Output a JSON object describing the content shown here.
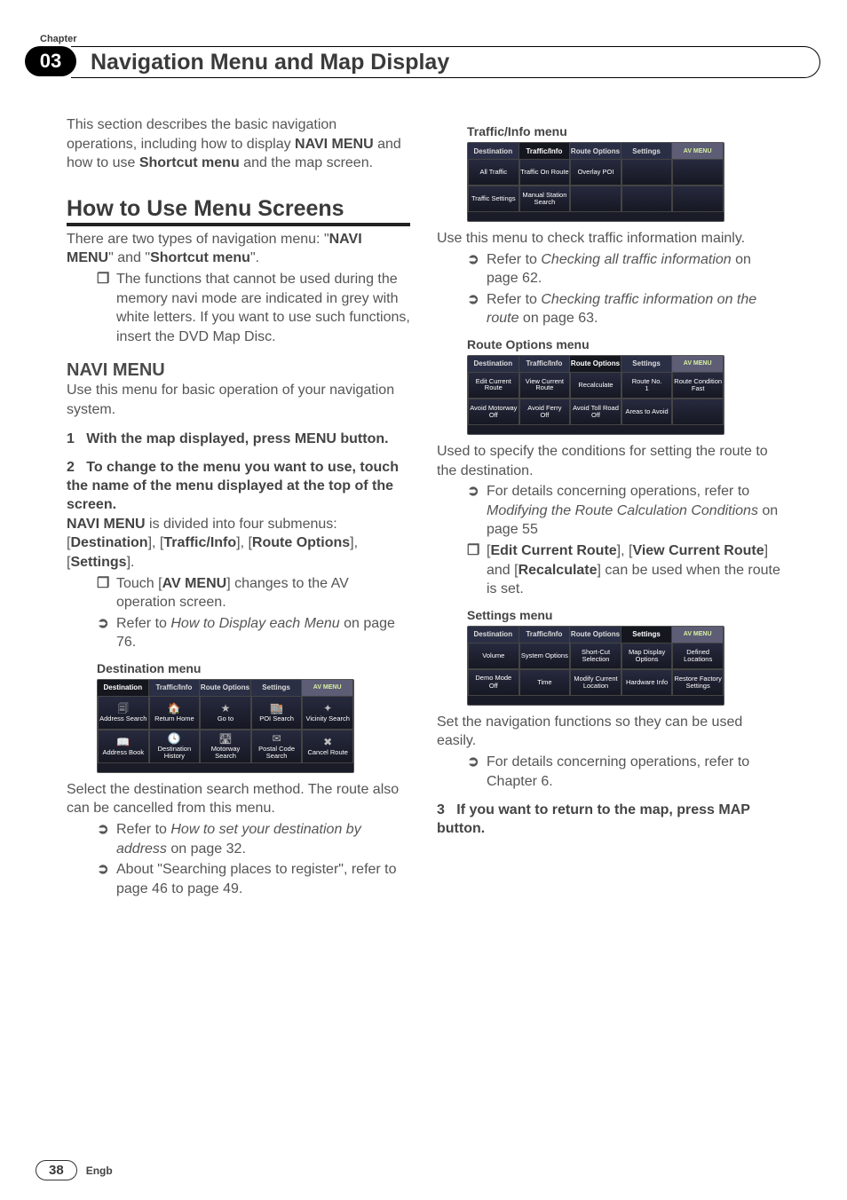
{
  "chapter": {
    "label": "Chapter",
    "number": "03",
    "title": "Navigation Menu and Map Display"
  },
  "footer": {
    "page": "38",
    "lang": "Engb"
  },
  "left": {
    "intro": "This section describes the basic navigation operations, including how to display ",
    "intro_b1": "NAVI MENU",
    "intro_mid": " and how to use ",
    "intro_b2": "Shortcut menu",
    "intro_end": " and the map screen.",
    "h1": "How to Use Menu Screens",
    "p1a": "There are two types of navigation menu: \"",
    "p1b": "NAVI MENU",
    "p1c": "\" and \"",
    "p1d": "Shortcut menu",
    "p1e": "\".",
    "b1": "The functions that cannot be used during the memory navi mode are indicated in grey with white letters. If you want to use such functions, insert the DVD Map Disc.",
    "h2": "NAVI MENU",
    "p2": "Use this menu for basic operation of your navigation system.",
    "s1n": "1",
    "s1": "With the map displayed, press MENU button.",
    "s2n": "2",
    "s2": "To change to the menu you want to use, touch the name of the menu displayed at the top of the screen.",
    "p3a": "NAVI MENU",
    "p3b": " is divided into four submenus: [",
    "p3c": "Destination",
    "p3d": "], [",
    "p3e": "Traffic/Info",
    "p3f": "], [",
    "p3g": "Route Options",
    "p3h": "], [",
    "p3i": "Settings",
    "p3j": "].",
    "b2a": "Touch [",
    "b2b": "AV MENU",
    "b2c": "] changes to the AV operation screen.",
    "b3a": "Refer to ",
    "b3b": "How to Display each Menu",
    "b3c": " on page 76.",
    "cap1": "Destination menu",
    "shot1": {
      "tabs": [
        "Destination",
        "Traffic/Info",
        "Route Options",
        "Settings",
        "AV MENU"
      ],
      "row1": [
        "Address Search",
        "Return Home",
        "Go to",
        "POI Search",
        "Vicinity Search"
      ],
      "row2": [
        "Address Book",
        "Destination History",
        "Motorway Search",
        "Postal Code Search",
        "Cancel Route"
      ]
    },
    "p4": "Select the destination search method. The route also can be cancelled from this menu.",
    "b4a": "Refer to ",
    "b4b": "How to set your destination by address",
    "b4c": " on page 32.",
    "b5": "About \"Searching places to register\", refer to page 46 to page 49."
  },
  "right": {
    "cap2": "Traffic/Info menu",
    "shot2": {
      "tabs": [
        "Destination",
        "Traffic/Info",
        "Route Options",
        "Settings",
        "AV MENU"
      ],
      "row1": [
        "All Traffic",
        "Traffic On Route",
        "Overlay POI",
        "",
        ""
      ],
      "row2": [
        "Traffic Settings",
        "Manual Station Search",
        "",
        "",
        ""
      ]
    },
    "p5": "Use this menu to check traffic information mainly.",
    "b6a": "Refer to ",
    "b6b": "Checking all traffic information",
    "b6c": " on page 62.",
    "b7a": "Refer to ",
    "b7b": "Checking traffic information on the route",
    "b7c": " on page 63.",
    "cap3": "Route Options menu",
    "shot3": {
      "tabs": [
        "Destination",
        "Traffic/Info",
        "Route Options",
        "Settings",
        "AV MENU"
      ],
      "row1": [
        "Edit Current Route",
        "View Current Route",
        "Recalculate",
        "Route No.",
        "Route Condition"
      ],
      "row1sub": [
        "",
        "",
        "",
        "1",
        "Fast"
      ],
      "row2": [
        "Avoid Motorway",
        "Avoid Ferry",
        "Avoid Toll Road",
        "Areas to Avoid",
        ""
      ],
      "row2sub": [
        "Off",
        "Off",
        "Off",
        "",
        ""
      ]
    },
    "p6": "Used to specify the conditions for setting the route to the destination.",
    "b8a": "For details concerning operations, refer to ",
    "b8b": "Modifying the Route Calculation Conditions",
    "b8c": " on page 55",
    "b9a": "[",
    "b9b": "Edit Current Route",
    "b9c": "], [",
    "b9d": "View Current Route",
    "b9e": "] and [",
    "b9f": "Recalculate",
    "b9g": "] can be used when the route is set.",
    "cap4": "Settings menu",
    "shot4": {
      "tabs": [
        "Destination",
        "Traffic/Info",
        "Route Options",
        "Settings",
        "AV MENU"
      ],
      "row1": [
        "Volume",
        "System Options",
        "Short-Cut Selection",
        "Map Display Options",
        "Defined Locations"
      ],
      "row2": [
        "Demo Mode",
        "Time",
        "Modify Current Location",
        "Hardware Info",
        "Restore Factory Settings"
      ],
      "row2sub": [
        "Off",
        "",
        "",
        "",
        ""
      ]
    },
    "p7": "Set the navigation functions so they can be used easily.",
    "b10": "For details concerning operations, refer to Chapter 6.",
    "s3n": "3",
    "s3": "If you want to return to the map, press MAP button."
  }
}
